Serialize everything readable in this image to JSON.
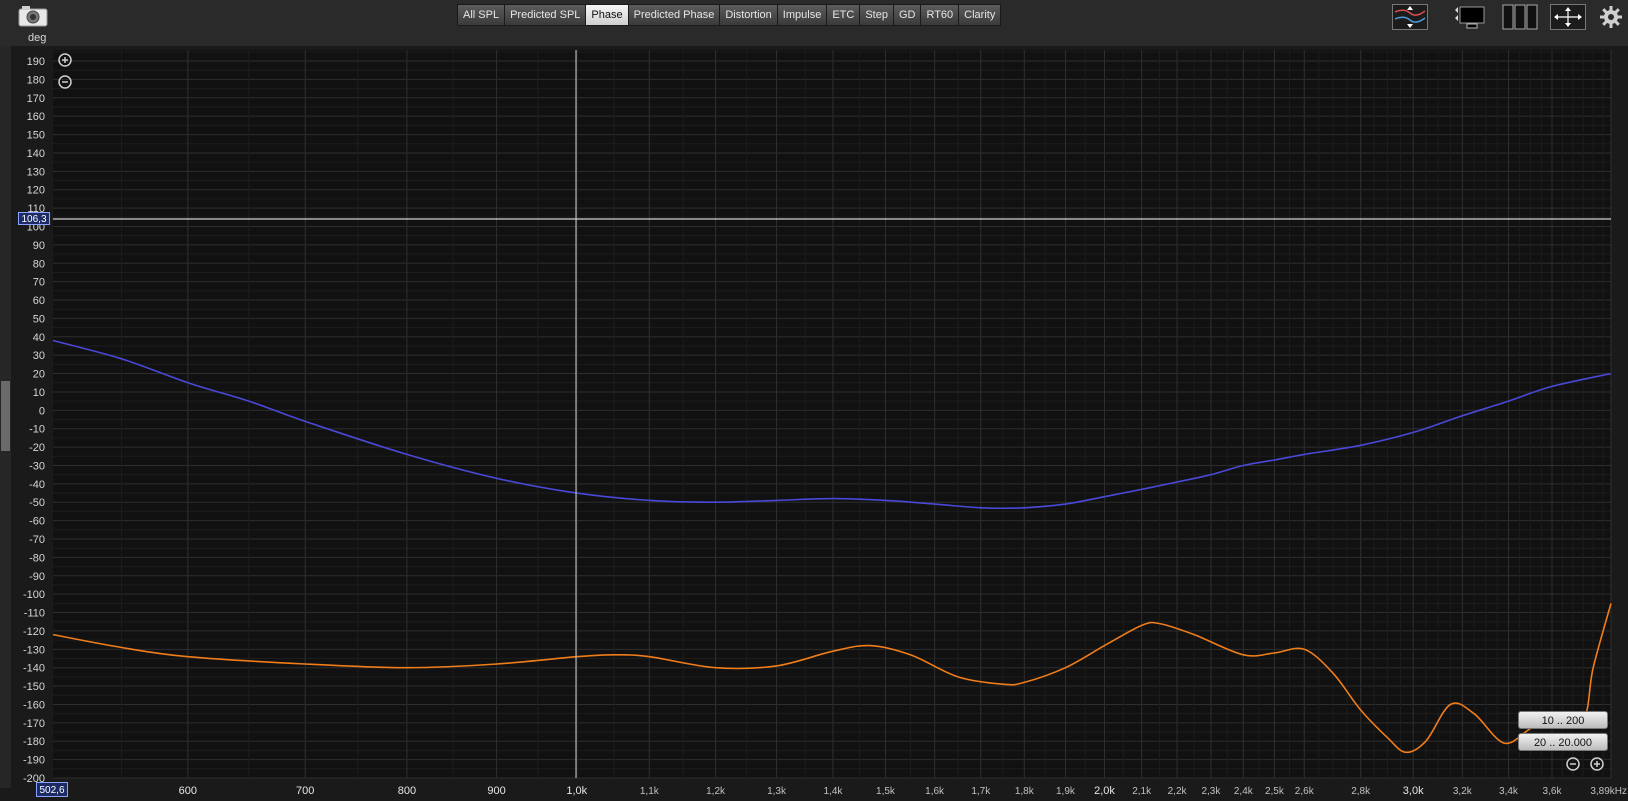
{
  "toolbar": {
    "unit": "deg",
    "tabs": [
      "All SPL",
      "Predicted SPL",
      "Phase",
      "Predicted Phase",
      "Distortion",
      "Impulse",
      "ETC",
      "Step",
      "GD",
      "RT60",
      "Clarity"
    ],
    "active_tab": "Phase"
  },
  "cursor": {
    "y_value": "106,3",
    "x_value": "502,6"
  },
  "range_buttons": [
    "10 .. 200",
    "20 .. 20.000"
  ],
  "chart_data": {
    "type": "line",
    "ylabel": "deg",
    "xlabel": "",
    "x_scale": "log",
    "xlim": [
      502.6,
      3890
    ],
    "ylim": [
      -200,
      196
    ],
    "grid": true,
    "y_ticks": [
      190,
      180,
      170,
      160,
      150,
      140,
      130,
      120,
      110,
      100,
      90,
      80,
      70,
      60,
      50,
      40,
      30,
      20,
      10,
      0,
      -10,
      -20,
      -30,
      -40,
      -50,
      -60,
      -70,
      -80,
      -90,
      -100,
      -110,
      -120,
      -130,
      -140,
      -150,
      -160,
      -170,
      -180,
      -190,
      -200
    ],
    "x_ticks": [
      {
        "v": 600,
        "label": "600"
      },
      {
        "v": 700,
        "label": "700"
      },
      {
        "v": 800,
        "label": "800"
      },
      {
        "v": 900,
        "label": "900"
      },
      {
        "v": 1000,
        "label": "1,0k"
      },
      {
        "v": 1100,
        "label": "1,1k"
      },
      {
        "v": 1200,
        "label": "1,2k"
      },
      {
        "v": 1300,
        "label": "1,3k"
      },
      {
        "v": 1400,
        "label": "1,4k"
      },
      {
        "v": 1500,
        "label": "1,5k"
      },
      {
        "v": 1600,
        "label": "1,6k"
      },
      {
        "v": 1700,
        "label": "1,7k"
      },
      {
        "v": 1800,
        "label": "1,8k"
      },
      {
        "v": 1900,
        "label": "1,9k"
      },
      {
        "v": 2000,
        "label": "2,0k"
      },
      {
        "v": 2100,
        "label": "2,1k"
      },
      {
        "v": 2200,
        "label": "2,2k"
      },
      {
        "v": 2300,
        "label": "2,3k"
      },
      {
        "v": 2400,
        "label": "2,4k"
      },
      {
        "v": 2500,
        "label": "2,5k"
      },
      {
        "v": 2600,
        "label": "2,6k"
      },
      {
        "v": 2800,
        "label": "2,8k"
      },
      {
        "v": 3000,
        "label": "3,0k"
      },
      {
        "v": 3200,
        "label": "3,2k"
      },
      {
        "v": 3400,
        "label": "3,4k"
      },
      {
        "v": 3600,
        "label": "3,6k"
      },
      {
        "v": 3890,
        "label": "3,89kHz"
      }
    ],
    "series": [
      {
        "color": "#4a48d8",
        "x": [
          502.6,
          550,
          600,
          650,
          700,
          800,
          900,
          1000,
          1100,
          1200,
          1300,
          1400,
          1500,
          1600,
          1700,
          1800,
          1900,
          2000,
          2100,
          2200,
          2300,
          2400,
          2500,
          2600,
          2800,
          3000,
          3200,
          3400,
          3600,
          3890
        ],
        "y": [
          38,
          28,
          15,
          5,
          -6,
          -24,
          -37,
          -45,
          -49,
          -50,
          -49,
          -48,
          -49,
          -51,
          -53,
          -53,
          -51,
          -47,
          -43,
          -39,
          -35,
          -30,
          -27,
          -24,
          -19,
          -12,
          -3,
          5,
          13,
          20
        ]
      },
      {
        "color": "#f07d1a",
        "x": [
          502.6,
          550,
          600,
          700,
          800,
          900,
          1000,
          1050,
          1100,
          1200,
          1300,
          1400,
          1470,
          1550,
          1650,
          1750,
          1800,
          1900,
          2000,
          2100,
          2150,
          2250,
          2400,
          2500,
          2600,
          2700,
          2800,
          2900,
          2970,
          3050,
          3150,
          3250,
          3380,
          3500,
          3600,
          3750,
          3800,
          3890
        ],
        "y": [
          -122,
          -129,
          -134,
          -138,
          -140,
          -138,
          -134,
          -133,
          -134,
          -140,
          -139,
          -131,
          -128,
          -133,
          -145,
          -149,
          -148,
          -140,
          -128,
          -117,
          -116,
          -122,
          -133,
          -132,
          -130,
          -143,
          -163,
          -178,
          -186,
          -180,
          -160,
          -165,
          -181,
          -173,
          -167,
          -168,
          -140,
          -105
        ]
      }
    ]
  }
}
